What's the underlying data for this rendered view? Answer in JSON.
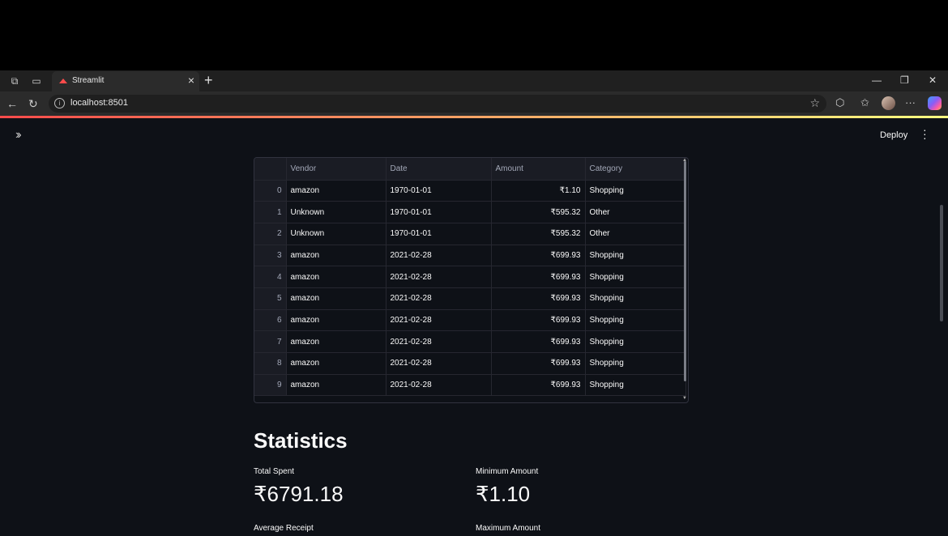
{
  "browser": {
    "tab_title": "Streamlit",
    "url": "localhost:8501"
  },
  "app": {
    "deploy_label": "Deploy",
    "table": {
      "columns": [
        "Vendor",
        "Date",
        "Amount",
        "Category"
      ],
      "rows": [
        {
          "index": "0",
          "vendor": "amazon",
          "date": "1970-01-01",
          "amount": "₹1.10",
          "category": "Shopping"
        },
        {
          "index": "1",
          "vendor": "Unknown",
          "date": "1970-01-01",
          "amount": "₹595.32",
          "category": "Other"
        },
        {
          "index": "2",
          "vendor": "Unknown",
          "date": "1970-01-01",
          "amount": "₹595.32",
          "category": "Other"
        },
        {
          "index": "3",
          "vendor": "amazon",
          "date": "2021-02-28",
          "amount": "₹699.93",
          "category": "Shopping"
        },
        {
          "index": "4",
          "vendor": "amazon",
          "date": "2021-02-28",
          "amount": "₹699.93",
          "category": "Shopping"
        },
        {
          "index": "5",
          "vendor": "amazon",
          "date": "2021-02-28",
          "amount": "₹699.93",
          "category": "Shopping"
        },
        {
          "index": "6",
          "vendor": "amazon",
          "date": "2021-02-28",
          "amount": "₹699.93",
          "category": "Shopping"
        },
        {
          "index": "7",
          "vendor": "amazon",
          "date": "2021-02-28",
          "amount": "₹699.93",
          "category": "Shopping"
        },
        {
          "index": "8",
          "vendor": "amazon",
          "date": "2021-02-28",
          "amount": "₹699.93",
          "category": "Shopping"
        },
        {
          "index": "9",
          "vendor": "amazon",
          "date": "2021-02-28",
          "amount": "₹699.93",
          "category": "Shopping"
        }
      ]
    },
    "statistics": {
      "heading": "Statistics",
      "total_spent_label": "Total Spent",
      "total_spent_value": "₹6791.18",
      "minimum_amount_label": "Minimum Amount",
      "minimum_amount_value": "₹1.10",
      "average_receipt_label": "Average Receipt",
      "maximum_amount_label": "Maximum Amount"
    }
  }
}
